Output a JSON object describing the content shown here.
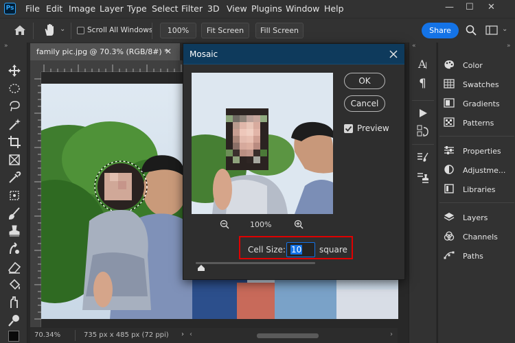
{
  "app": {
    "logo": "Ps"
  },
  "menu": [
    "File",
    "Edit",
    "Image",
    "Layer",
    "Type",
    "Select",
    "Filter",
    "3D",
    "View",
    "Plugins",
    "Window",
    "Help"
  ],
  "options_bar": {
    "scroll_all_windows": "Scroll All Windows",
    "zoom_value": "100%",
    "fit_screen": "Fit Screen",
    "fill_screen": "Fill Screen",
    "share": "Share"
  },
  "document": {
    "tab_title": "family pic.jpg @ 70.3% (RGB/8#) *",
    "zoom_status": "70.34%",
    "size_status": "735 px x 485 px (72 ppi)"
  },
  "dialog": {
    "title": "Mosaic",
    "ok_label": "OK",
    "cancel_label": "Cancel",
    "preview_label": "Preview",
    "preview_checked": true,
    "preview_zoom": "100%",
    "cell_size_label": "Cell Size:",
    "cell_size_value": "10",
    "cell_size_unit": "square",
    "slider_position": 0.02
  },
  "panels": {
    "group1": [
      "Color",
      "Swatches",
      "Gradients",
      "Patterns"
    ],
    "group2": [
      "Properties",
      "Adjustme...",
      "Libraries"
    ],
    "group3": [
      "Layers",
      "Channels",
      "Paths"
    ]
  },
  "colors": {
    "accent": "#1473e6",
    "highlight": "#e00000",
    "title_bar": "#0e3a5c"
  }
}
